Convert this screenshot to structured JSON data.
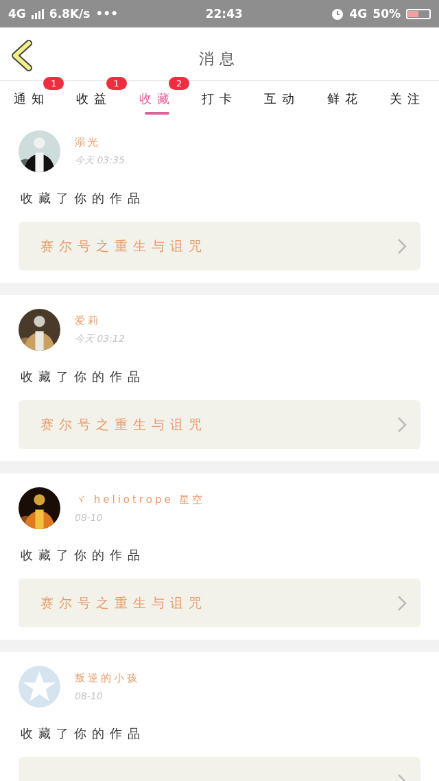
{
  "status_bar": {
    "network": "4G",
    "speed": "6.8K/s",
    "more": "•••",
    "time": "22:43",
    "network_right": "4G",
    "battery": "50%"
  },
  "header": {
    "title": "消息"
  },
  "tabs": [
    {
      "label": "通知",
      "selected": false,
      "badge": "1"
    },
    {
      "label": "收益",
      "selected": false,
      "badge": "1"
    },
    {
      "label": "收藏",
      "selected": true,
      "badge": "2"
    },
    {
      "label": "打卡",
      "selected": false
    },
    {
      "label": "互动",
      "selected": false
    },
    {
      "label": "鲜花",
      "selected": false
    },
    {
      "label": "关注",
      "selected": false
    }
  ],
  "messages": [
    {
      "name": "溺光",
      "time": "今天 03:35",
      "action": "收藏了你的作品",
      "work": "赛尔号之重生与诅咒",
      "kind": "picture"
    },
    {
      "name": "爱莉",
      "time": "今天 03:12",
      "action": "收藏了你的作品",
      "work": "赛尔号之重生与诅咒",
      "kind": "picture"
    },
    {
      "name": "ヾ heliotrope 星空",
      "time": "08-10",
      "action": "收藏了你的作品",
      "work": "赛尔号之重生与诅咒",
      "kind": "picture"
    },
    {
      "name": "叛逆的小孩",
      "time": "08-10",
      "action": "收藏了你的作品",
      "kind": "default"
    }
  ]
}
